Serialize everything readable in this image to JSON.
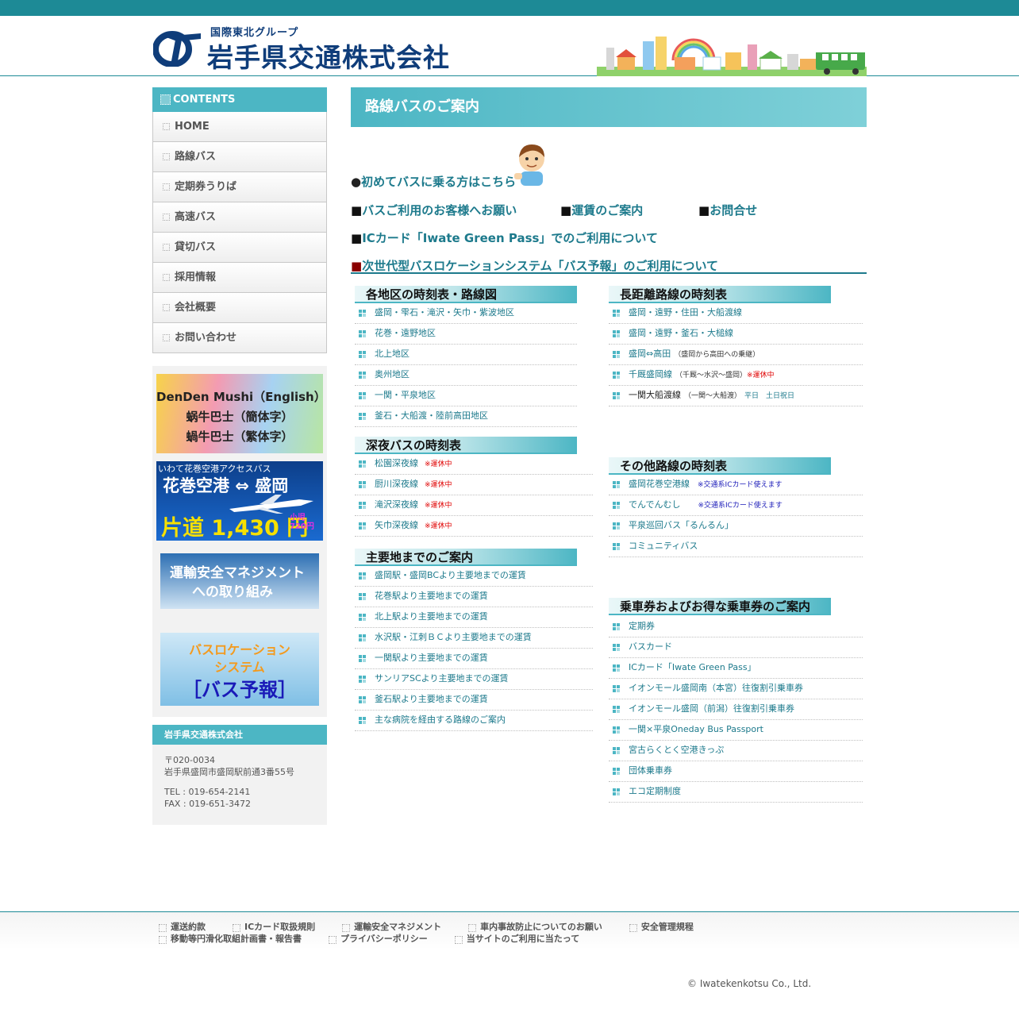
{
  "header": {
    "group": "国際東北グループ",
    "company": "岩手県交通株式会社"
  },
  "sidebar": {
    "contents_title": "CONTENTS",
    "items": [
      "HOME",
      "路線バス",
      "定期券うりば",
      "高速バス",
      "貸切バス",
      "採用情報",
      "会社概要",
      "お問い合わせ"
    ],
    "banners": {
      "denden": [
        "DenDen Mushi（English）",
        "蜗牛巴士（簡体字）",
        "蝸牛巴士（繁体字）"
      ],
      "airport": {
        "line1": "いわて花巻空港アクセスバス",
        "line2": "花巻空港 ⇔ 盛岡",
        "price": "片道 1,430 円",
        "child": "小児 720円"
      },
      "safety": [
        "運輸安全マネジメント",
        "への取り組み"
      ],
      "location": [
        "バスロケーション",
        "システム",
        "［バス予報］"
      ]
    },
    "company_title": "岩手県交通株式会社",
    "postal": "〒020-0034",
    "address": "岩手県盛岡市盛岡駅前通3番55号",
    "tel": "TEL : 019-654-2141",
    "fax": "FAX : 019-651-3472"
  },
  "main": {
    "title": "路線バスのご案内",
    "first_bullet": "●",
    "first_link": "初めてバスに乗る方はこちら",
    "square": "■",
    "links_row": [
      "バスご利用のお客様へお願い",
      "運賃のご案内",
      "お問合せ"
    ],
    "ic_link": "ICカード「Iwate Green Pass」でのご利用について",
    "next_link": "次世代型バスロケーションシステム「バス予報」のご利用について"
  },
  "sections": {
    "timetable": {
      "title": "各地区の時刻表・路線図",
      "items": [
        "盛岡・雫石・滝沢・矢巾・紫波地区",
        "花巻・遠野地区",
        "北上地区",
        "奥州地区",
        "一関・平泉地区",
        "釜石・大船渡・陸前高田地区"
      ]
    },
    "long": {
      "title": "長距離路線の時刻表",
      "items": [
        {
          "label": "盛岡・遠野・住田・大船渡線"
        },
        {
          "label": "盛岡・遠野・釜石・大槌線"
        },
        {
          "label": "盛岡⇔高田",
          "note": "（盛岡から高田への乗継）"
        },
        {
          "label": "千厩盛岡線",
          "note": "（千厩～水沢～盛岡）",
          "red": "※運休中"
        },
        {
          "label": "一関大船渡線",
          "note": "（一関～大船渡）",
          "teal": "平日　土日祝日"
        }
      ]
    },
    "night": {
      "title": "深夜バスの時刻表",
      "status": "※運休中",
      "items": [
        "松園深夜線",
        "厨川深夜線",
        "滝沢深夜線",
        "矢巾深夜線"
      ]
    },
    "other": {
      "title": "その他路線の時刻表",
      "items": [
        {
          "label": "盛岡花巻空港線",
          "blue": "※交通系ICカード使えます"
        },
        {
          "label": "でんでんむし",
          "blue": "※交通系ICカード使えます"
        },
        {
          "label": "平泉巡回バス「るんるん」"
        },
        {
          "label": "コミュニティバス"
        }
      ]
    },
    "fare": {
      "title": "主要地までのご案内",
      "items": [
        "盛岡駅・盛岡BCより主要地までの運賃",
        "花巻駅より主要地までの運賃",
        "北上駅より主要地までの運賃",
        "水沢駅・江刺ＢＣより主要地までの運賃",
        "一関駅より主要地までの運賃",
        "サンリアSCより主要地までの運賃",
        "釜石駅より主要地までの運賃",
        "主な病院を経由する路線のご案内"
      ]
    },
    "tickets": {
      "title": "乗車券およびお得な乗車券のご案内",
      "items": [
        "定期券",
        "バスカード",
        "ICカード「Iwate Green Pass」",
        "イオンモール盛岡南（本宮）往復割引乗車券",
        "イオンモール盛岡（前潟）往復割引乗車券",
        "一関×平泉Oneday Bus Passport",
        "宮古らくとく空港きっぷ",
        "団体乗車券",
        "エコ定期制度"
      ]
    }
  },
  "footer": {
    "row1": [
      "運送約款",
      "ICカード取扱規則",
      "運輸安全マネジメント",
      "車内事故防止についてのお願い",
      "安全管理規程"
    ],
    "row2": [
      "移動等円滑化取組計画書・報告書",
      "プライバシーポリシー",
      "当サイトのご利用に当たって"
    ],
    "copyright": "© Iwatekenkotsu Co., Ltd."
  },
  "colors": {
    "brand": "#1d8a96",
    "accent": "#4cb6c4",
    "link": "#1d7a8c",
    "logo": "#0f3d7a",
    "alert": "#e00000"
  },
  "icons": {
    "contents": "contents-icon",
    "nav": "dotted-square-icon",
    "list": "grid-square-icon",
    "kid": "boy-icon"
  }
}
